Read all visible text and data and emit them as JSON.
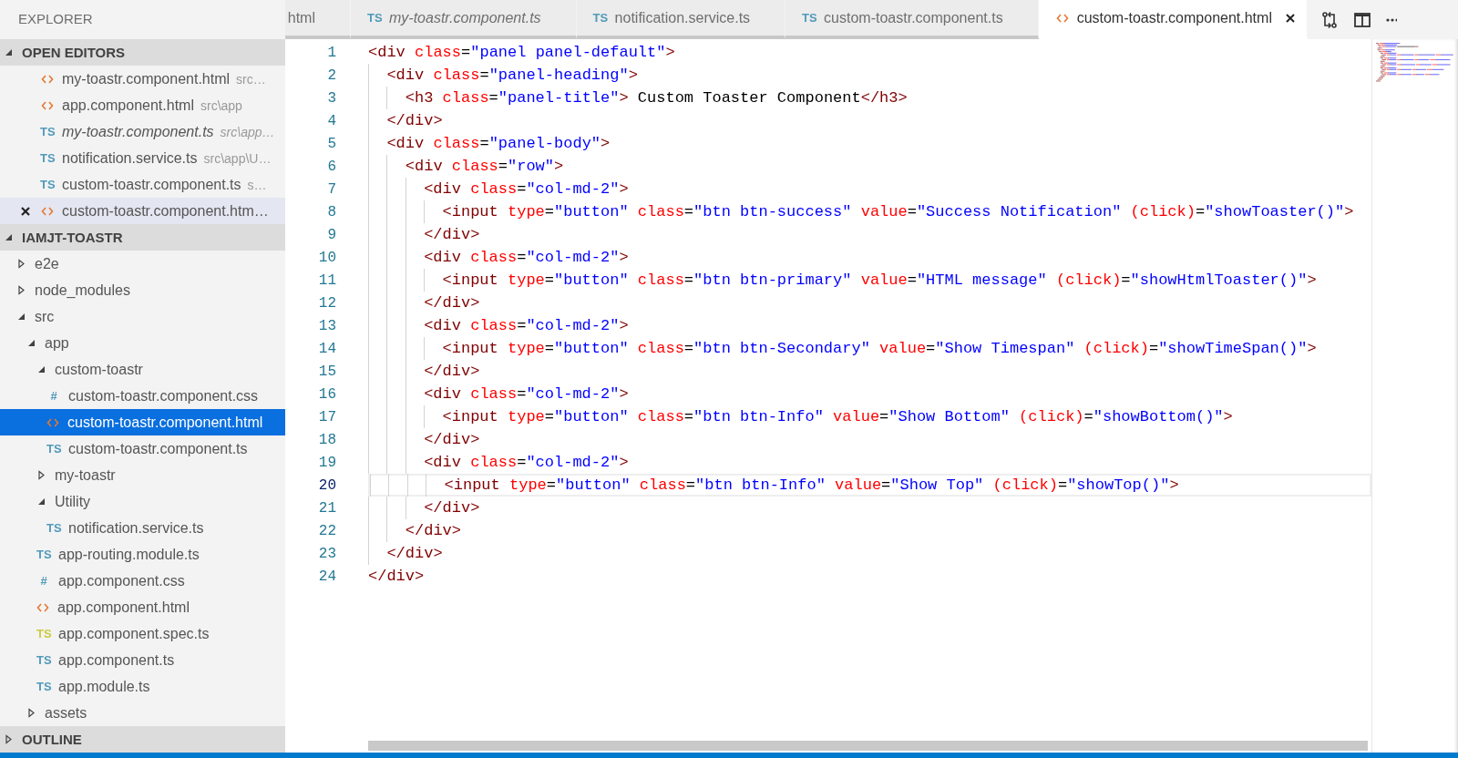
{
  "sidebar": {
    "title": "EXPLORER",
    "sections": [
      {
        "kind": "editors",
        "title": "OPEN EDITORS",
        "expanded": true,
        "items": [
          {
            "kind": "html",
            "name": "my-toastr.component.html",
            "path": "src…",
            "preview": false,
            "selected": false
          },
          {
            "kind": "html",
            "name": "app.component.html",
            "path": "src\\app",
            "preview": false,
            "selected": false
          },
          {
            "kind": "ts",
            "badge": "TS",
            "name": "my-toastr.component.ts",
            "path": "src\\app…",
            "preview": true,
            "selected": false
          },
          {
            "kind": "ts",
            "badge": "TS",
            "name": "notification.service.ts",
            "path": "src\\app\\U…",
            "preview": false,
            "selected": false
          },
          {
            "kind": "ts",
            "badge": "TS",
            "name": "custom-toastr.component.ts",
            "path": "s…",
            "preview": false,
            "selected": false
          },
          {
            "kind": "html",
            "name": "custom-toastr.component.htm…",
            "preview": false,
            "selected": true
          }
        ]
      },
      {
        "kind": "tree",
        "title": "IAMJT-TOASTR",
        "expanded": true,
        "children": [
          {
            "kind": "folder",
            "name": "e2e",
            "expanded": false,
            "selected": false
          },
          {
            "kind": "folder",
            "name": "node_modules",
            "expanded": false,
            "selected": false
          },
          {
            "kind": "folder",
            "name": "src",
            "expanded": true,
            "selected": false,
            "children": [
              {
                "kind": "folder",
                "name": "app",
                "expanded": true,
                "selected": false,
                "children": [
                  {
                    "kind": "folder",
                    "name": "custom-toastr",
                    "expanded": true,
                    "selected": false,
                    "children": [
                      {
                        "kind": "css",
                        "badge": "#",
                        "name": "custom-toastr.component.css",
                        "selected": false
                      },
                      {
                        "kind": "html",
                        "name": "custom-toastr.component.html",
                        "selected": true
                      },
                      {
                        "kind": "ts",
                        "badge": "TS",
                        "name": "custom-toastr.component.ts",
                        "selected": false
                      }
                    ]
                  },
                  {
                    "kind": "folder",
                    "name": "my-toastr",
                    "expanded": false,
                    "selected": false
                  },
                  {
                    "kind": "folder",
                    "name": "Utility",
                    "expanded": true,
                    "selected": false,
                    "children": [
                      {
                        "kind": "ts",
                        "badge": "TS",
                        "name": "notification.service.ts",
                        "selected": false
                      }
                    ]
                  },
                  {
                    "kind": "ts",
                    "badge": "TS",
                    "name": "app-routing.module.ts",
                    "selected": false
                  },
                  {
                    "kind": "css",
                    "badge": "#",
                    "name": "app.component.css",
                    "selected": false
                  },
                  {
                    "kind": "html",
                    "name": "app.component.html",
                    "selected": false
                  },
                  {
                    "kind": "spec",
                    "badge": "TS",
                    "name": "app.component.spec.ts",
                    "selected": false
                  },
                  {
                    "kind": "ts",
                    "badge": "TS",
                    "name": "app.component.ts",
                    "selected": false
                  },
                  {
                    "kind": "ts",
                    "badge": "TS",
                    "name": "app.module.ts",
                    "selected": false
                  }
                ]
              },
              {
                "kind": "folder",
                "name": "assets",
                "expanded": false,
                "selected": false
              }
            ]
          }
        ]
      },
      {
        "kind": "tree",
        "title": "OUTLINE",
        "expanded": false
      }
    ]
  },
  "tabs": [
    {
      "label": "html",
      "preview": false,
      "selected": false
    },
    {
      "kind": "ts",
      "badge": "TS",
      "label": "my-toastr.component.ts",
      "preview": true,
      "selected": false
    },
    {
      "kind": "ts",
      "badge": "TS",
      "label": "notification.service.ts",
      "preview": false,
      "selected": false
    },
    {
      "kind": "ts",
      "badge": "TS",
      "label": "custom-toastr.component.ts",
      "preview": false,
      "selected": false
    },
    {
      "kind": "html",
      "label": "custom-toastr.component.html",
      "preview": false,
      "selected": true
    }
  ],
  "editor": {
    "lines": [
      {
        "number": "1",
        "current": false,
        "tokens": [
          {
            "kind": "tag",
            "text": "<div"
          },
          {
            "kind": "attr",
            "text": " class"
          },
          {
            "kind": "plain",
            "text": "="
          },
          {
            "kind": "value",
            "text": "\"panel panel-default\""
          },
          {
            "kind": "tag",
            "text": ">"
          }
        ]
      },
      {
        "number": "2",
        "current": false,
        "tokens": [
          {
            "kind": "tag",
            "text": "  <div"
          },
          {
            "kind": "attr",
            "text": " class"
          },
          {
            "kind": "plain",
            "text": "="
          },
          {
            "kind": "value",
            "text": "\"panel-heading\""
          },
          {
            "kind": "tag",
            "text": ">"
          }
        ]
      },
      {
        "number": "3",
        "current": false,
        "tokens": [
          {
            "kind": "tag",
            "text": "    <h3"
          },
          {
            "kind": "attr",
            "text": " class"
          },
          {
            "kind": "plain",
            "text": "="
          },
          {
            "kind": "value",
            "text": "\"panel-title\""
          },
          {
            "kind": "tag",
            "text": ">"
          },
          {
            "kind": "plain",
            "text": " Custom Toaster Component"
          },
          {
            "kind": "tag",
            "text": "</h3>"
          }
        ]
      },
      {
        "number": "4",
        "current": false,
        "tokens": [
          {
            "kind": "tag",
            "text": "  </div>"
          }
        ]
      },
      {
        "number": "5",
        "current": false,
        "tokens": [
          {
            "kind": "tag",
            "text": "  <div"
          },
          {
            "kind": "attr",
            "text": " class"
          },
          {
            "kind": "plain",
            "text": "="
          },
          {
            "kind": "value",
            "text": "\"panel-body\""
          },
          {
            "kind": "tag",
            "text": ">"
          }
        ]
      },
      {
        "number": "6",
        "current": false,
        "tokens": [
          {
            "kind": "tag",
            "text": "    <div"
          },
          {
            "kind": "attr",
            "text": " class"
          },
          {
            "kind": "plain",
            "text": "="
          },
          {
            "kind": "value",
            "text": "\"row\""
          },
          {
            "kind": "tag",
            "text": ">"
          }
        ]
      },
      {
        "number": "7",
        "current": false,
        "tokens": [
          {
            "kind": "tag",
            "text": "      <div"
          },
          {
            "kind": "attr",
            "text": " class"
          },
          {
            "kind": "plain",
            "text": "="
          },
          {
            "kind": "value",
            "text": "\"col-md-2\""
          },
          {
            "kind": "tag",
            "text": ">"
          }
        ]
      },
      {
        "number": "8",
        "current": false,
        "tokens": [
          {
            "kind": "tag",
            "text": "        <input"
          },
          {
            "kind": "attr",
            "text": " type"
          },
          {
            "kind": "plain",
            "text": "="
          },
          {
            "kind": "value",
            "text": "\"button\""
          },
          {
            "kind": "attr",
            "text": " class"
          },
          {
            "kind": "plain",
            "text": "="
          },
          {
            "kind": "value",
            "text": "\"btn btn-success\""
          },
          {
            "kind": "attr",
            "text": " value"
          },
          {
            "kind": "plain",
            "text": "="
          },
          {
            "kind": "value",
            "text": "\"Success Notification\""
          },
          {
            "kind": "attr",
            "text": " (click)"
          },
          {
            "kind": "plain",
            "text": "="
          },
          {
            "kind": "value",
            "text": "\"showToaster()\""
          },
          {
            "kind": "tag",
            "text": ">"
          }
        ]
      },
      {
        "number": "9",
        "current": false,
        "tokens": [
          {
            "kind": "tag",
            "text": "      </div>"
          }
        ]
      },
      {
        "number": "10",
        "current": false,
        "tokens": [
          {
            "kind": "tag",
            "text": "      <div"
          },
          {
            "kind": "attr",
            "text": " class"
          },
          {
            "kind": "plain",
            "text": "="
          },
          {
            "kind": "value",
            "text": "\"col-md-2\""
          },
          {
            "kind": "tag",
            "text": ">"
          }
        ]
      },
      {
        "number": "11",
        "current": false,
        "tokens": [
          {
            "kind": "tag",
            "text": "        <input"
          },
          {
            "kind": "attr",
            "text": " type"
          },
          {
            "kind": "plain",
            "text": "="
          },
          {
            "kind": "value",
            "text": "\"button\""
          },
          {
            "kind": "attr",
            "text": " class"
          },
          {
            "kind": "plain",
            "text": "="
          },
          {
            "kind": "value",
            "text": "\"btn btn-primary\""
          },
          {
            "kind": "attr",
            "text": " value"
          },
          {
            "kind": "plain",
            "text": "="
          },
          {
            "kind": "value",
            "text": "\"HTML message\""
          },
          {
            "kind": "attr",
            "text": " (click)"
          },
          {
            "kind": "plain",
            "text": "="
          },
          {
            "kind": "value",
            "text": "\"showHtmlToaster()\""
          },
          {
            "kind": "tag",
            "text": ">"
          }
        ]
      },
      {
        "number": "12",
        "current": false,
        "tokens": [
          {
            "kind": "tag",
            "text": "      </div>"
          }
        ]
      },
      {
        "number": "13",
        "current": false,
        "tokens": [
          {
            "kind": "tag",
            "text": "      <div"
          },
          {
            "kind": "attr",
            "text": " class"
          },
          {
            "kind": "plain",
            "text": "="
          },
          {
            "kind": "value",
            "text": "\"col-md-2\""
          },
          {
            "kind": "tag",
            "text": ">"
          }
        ]
      },
      {
        "number": "14",
        "current": false,
        "tokens": [
          {
            "kind": "tag",
            "text": "        <input"
          },
          {
            "kind": "attr",
            "text": " type"
          },
          {
            "kind": "plain",
            "text": "="
          },
          {
            "kind": "value",
            "text": "\"button\""
          },
          {
            "kind": "attr",
            "text": " class"
          },
          {
            "kind": "plain",
            "text": "="
          },
          {
            "kind": "value",
            "text": "\"btn btn-Secondary\""
          },
          {
            "kind": "attr",
            "text": " value"
          },
          {
            "kind": "plain",
            "text": "="
          },
          {
            "kind": "value",
            "text": "\"Show Timespan\""
          },
          {
            "kind": "attr",
            "text": " (click)"
          },
          {
            "kind": "plain",
            "text": "="
          },
          {
            "kind": "value",
            "text": "\"showTimeSpan()\""
          },
          {
            "kind": "tag",
            "text": ">"
          }
        ]
      },
      {
        "number": "15",
        "current": false,
        "tokens": [
          {
            "kind": "tag",
            "text": "      </div>"
          }
        ]
      },
      {
        "number": "16",
        "current": false,
        "tokens": [
          {
            "kind": "tag",
            "text": "      <div"
          },
          {
            "kind": "attr",
            "text": " class"
          },
          {
            "kind": "plain",
            "text": "="
          },
          {
            "kind": "value",
            "text": "\"col-md-2\""
          },
          {
            "kind": "tag",
            "text": ">"
          }
        ]
      },
      {
        "number": "17",
        "current": false,
        "tokens": [
          {
            "kind": "tag",
            "text": "        <input"
          },
          {
            "kind": "attr",
            "text": " type"
          },
          {
            "kind": "plain",
            "text": "="
          },
          {
            "kind": "value",
            "text": "\"button\""
          },
          {
            "kind": "attr",
            "text": " class"
          },
          {
            "kind": "plain",
            "text": "="
          },
          {
            "kind": "value",
            "text": "\"btn btn-Info\""
          },
          {
            "kind": "attr",
            "text": " value"
          },
          {
            "kind": "plain",
            "text": "="
          },
          {
            "kind": "value",
            "text": "\"Show Bottom\""
          },
          {
            "kind": "attr",
            "text": " (click)"
          },
          {
            "kind": "plain",
            "text": "="
          },
          {
            "kind": "value",
            "text": "\"showBottom()\""
          },
          {
            "kind": "tag",
            "text": ">"
          }
        ]
      },
      {
        "number": "18",
        "current": false,
        "tokens": [
          {
            "kind": "tag",
            "text": "      </div>"
          }
        ]
      },
      {
        "number": "19",
        "current": false,
        "tokens": [
          {
            "kind": "tag",
            "text": "      <div"
          },
          {
            "kind": "attr",
            "text": " class"
          },
          {
            "kind": "plain",
            "text": "="
          },
          {
            "kind": "value",
            "text": "\"col-md-2\""
          },
          {
            "kind": "tag",
            "text": ">"
          }
        ]
      },
      {
        "number": "20",
        "current": true,
        "tokens": [
          {
            "kind": "tag",
            "text": "        <input"
          },
          {
            "kind": "attr",
            "text": " type"
          },
          {
            "kind": "plain",
            "text": "="
          },
          {
            "kind": "value",
            "text": "\"button\""
          },
          {
            "kind": "attr",
            "text": " class"
          },
          {
            "kind": "plain",
            "text": "="
          },
          {
            "kind": "value",
            "text": "\"btn btn-Info\""
          },
          {
            "kind": "attr",
            "text": " value"
          },
          {
            "kind": "plain",
            "text": "="
          },
          {
            "kind": "value",
            "text": "\"Show Top\""
          },
          {
            "kind": "attr",
            "text": " (click)"
          },
          {
            "kind": "plain",
            "text": "="
          },
          {
            "kind": "value",
            "text": "\"showTop()\""
          },
          {
            "kind": "tag",
            "text": ">"
          }
        ]
      },
      {
        "number": "21",
        "current": false,
        "tokens": [
          {
            "kind": "tag",
            "text": "      </div>"
          }
        ]
      },
      {
        "number": "22",
        "current": false,
        "tokens": [
          {
            "kind": "tag",
            "text": "    </div>"
          }
        ]
      },
      {
        "number": "23",
        "current": false,
        "tokens": [
          {
            "kind": "tag",
            "text": "  </div>"
          }
        ]
      },
      {
        "number": "24",
        "current": false,
        "tokens": [
          {
            "kind": "tag",
            "text": "</div>"
          }
        ]
      }
    ]
  }
}
